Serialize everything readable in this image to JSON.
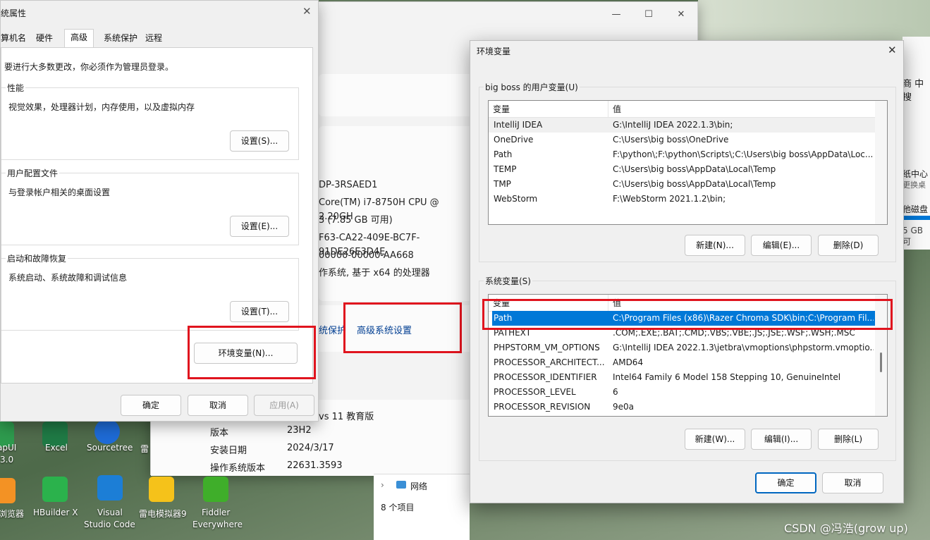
{
  "about_window": {
    "device_lines": [
      "DP-3RSAED1",
      "Core(TM) i7-8750H CPU @ 2.20GH",
      "3 (7.85 GB 可用)",
      "F63-CA22-409E-BC7F-91DE26E3D4E",
      "00000-00000-AA668",
      "作系统, 基于 x64 的处理器"
    ],
    "link_protection": "统保护",
    "link_advanced": "高级系统设置",
    "os_edition_partial": "vs 11 教育版",
    "specs": [
      {
        "k": "版本",
        "v": "23H2"
      },
      {
        "k": "安装日期",
        "v": "2024/3/17"
      },
      {
        "k": "操作系统版本",
        "v": "22631.3593"
      }
    ],
    "min_icon": "minimize-icon",
    "max_icon": "maximize-icon",
    "close_icon": "close-icon"
  },
  "right_edge": {
    "search": "商 中搜",
    "t1": "纸中心",
    "t2": "更换桌",
    "t3": "他磁盘",
    "t4": "5 GB 可"
  },
  "explorer": {
    "network": "网络",
    "count": "8 个项目"
  },
  "sysprop": {
    "title": "统属性",
    "tabs": [
      "算机名",
      "硬件",
      "高级",
      "系统保护",
      "远程"
    ],
    "admin_note": "要进行大多数更改，你必须作为管理员登录。",
    "perf_title": "性能",
    "perf_desc": "视觉效果，处理器计划，内存使用，以及虚拟内存",
    "perf_btn": "设置(S)...",
    "profile_title": "用户配置文件",
    "profile_desc": "与登录帐户相关的桌面设置",
    "profile_btn": "设置(E)...",
    "startup_title": "启动和故障恢复",
    "startup_desc": "系统启动、系统故障和调试信息",
    "startup_btn": "设置(T)...",
    "env_btn": "环境变量(N)...",
    "ok": "确定",
    "cancel": "取消",
    "apply": "应用(A)"
  },
  "env": {
    "title": "环境变量",
    "user_group": "big boss 的用户变量(U)",
    "col_var": "变量",
    "col_val": "值",
    "user_vars": [
      {
        "name": "IntelliJ IDEA",
        "value": "G:\\IntelliJ IDEA 2022.1.3\\bin;"
      },
      {
        "name": "OneDrive",
        "value": "C:\\Users\\big boss\\OneDrive"
      },
      {
        "name": "Path",
        "value": "F:\\python\\;F:\\python\\Scripts\\;C:\\Users\\big boss\\AppData\\Loc..."
      },
      {
        "name": "TEMP",
        "value": "C:\\Users\\big boss\\AppData\\Local\\Temp"
      },
      {
        "name": "TMP",
        "value": "C:\\Users\\big boss\\AppData\\Local\\Temp"
      },
      {
        "name": "WebStorm",
        "value": "F:\\WebStorm 2021.1.2\\bin;"
      }
    ],
    "user_new": "新建(N)...",
    "user_edit": "编辑(E)...",
    "user_del": "删除(D)",
    "sys_group": "系统变量(S)",
    "sys_vars": [
      {
        "name": "Path",
        "value": "C:\\Program Files (x86)\\Razer Chroma SDK\\bin;C:\\Program Fil..."
      },
      {
        "name": "PATHEXT",
        "value": ".COM;.EXE;.BAT;.CMD;.VBS;.VBE;.JS;.JSE;.WSF;.WSH;.MSC"
      },
      {
        "name": "PHPSTORM_VM_OPTIONS",
        "value": "G:\\IntelliJ IDEA 2022.1.3\\jetbra\\vmoptions\\phpstorm.vmoptio..."
      },
      {
        "name": "PROCESSOR_ARCHITECT...",
        "value": "AMD64"
      },
      {
        "name": "PROCESSOR_IDENTIFIER",
        "value": "Intel64 Family 6 Model 158 Stepping 10, GenuineIntel"
      },
      {
        "name": "PROCESSOR_LEVEL",
        "value": "6"
      },
      {
        "name": "PROCESSOR_REVISION",
        "value": "9e0a"
      }
    ],
    "sys_new": "新建(W)...",
    "sys_edit": "编辑(I)...",
    "sys_del": "删除(L)",
    "ok": "确定",
    "cancel": "取消"
  },
  "desktop": {
    "row1": [
      "apUI",
      "Excel",
      "Sourcetree",
      "雷"
    ],
    "row1b": "3.0",
    "row2": [
      "浏览器",
      "HBuilder X",
      "Visual",
      "雷电模拟器9",
      "Fiddler"
    ],
    "row2b": [
      "Studio Code",
      "Everywhere"
    ],
    "watermark": "CSDN @冯浩(grow up)"
  },
  "colors": {
    "accent": "#0078d7",
    "highlight": "#e0141e"
  }
}
